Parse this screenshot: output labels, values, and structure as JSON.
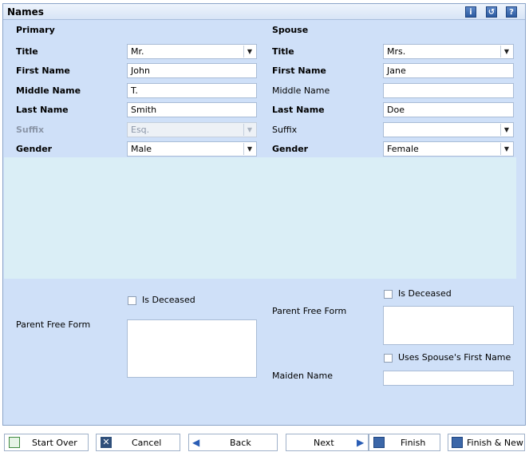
{
  "header": {
    "title": "Names",
    "icons": [
      "info-icon",
      "undo-icon",
      "help-icon"
    ]
  },
  "primary": {
    "heading": "Primary",
    "title_label": "Title",
    "title_value": "Mr.",
    "first_label": "First Name",
    "first_value": "John",
    "middle_label": "Middle Name",
    "middle_value": "T.",
    "last_label": "Last Name",
    "last_value": "Smith",
    "suffix_label": "Suffix",
    "suffix_value": "Esq.",
    "gender_label": "Gender",
    "gender_value": "Male",
    "deceased_label": "Is Deceased",
    "parent_label": "Parent Free Form"
  },
  "spouse": {
    "heading": "Spouse",
    "title_label": "Title",
    "title_value": "Mrs.",
    "first_label": "First Name",
    "first_value": "Jane",
    "middle_label": "Middle Name",
    "middle_value": "",
    "last_label": "Last Name",
    "last_value": "Doe",
    "suffix_label": "Suffix",
    "suffix_value": "",
    "gender_label": "Gender",
    "gender_value": "Female",
    "deceased_label": "Is Deceased",
    "parent_label": "Parent Free Form",
    "uses_first_label": "Uses Spouse's First Name",
    "maiden_label": "Maiden Name",
    "maiden_value": ""
  },
  "footer": {
    "start_over": "Start Over",
    "cancel": "Cancel",
    "back": "Back",
    "next": "Next",
    "finish": "Finish",
    "finish_new": "Finish & New"
  }
}
